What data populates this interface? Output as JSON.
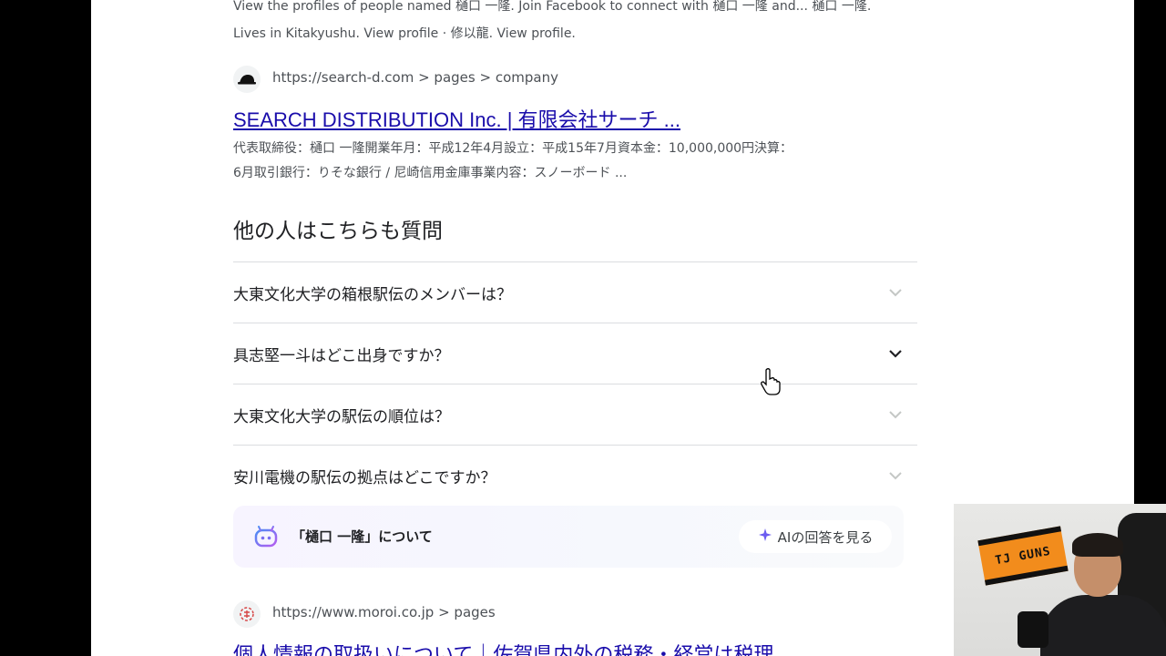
{
  "top_snippet": {
    "line1": "View the profiles of people named 樋口 一隆. Join Facebook to connect with 樋口 一隆 and... 樋口 一隆.",
    "line2": "Lives in Kitakyushu. View profile · 修以龍. View profile."
  },
  "result1": {
    "favicon": "hat-icon",
    "cite": "https://search-d.com > pages > company",
    "title": "SEARCH DISTRIBUTION Inc. | 有限会社サーチ ...",
    "desc_line1": "代表取締役：樋口 一隆開業年月：平成12年4月設立：平成15年7月資本金：10,000,000円決算：",
    "desc_line2": "6月取引銀行：りそな銀行 / 尼崎信用金庫事業内容：スノーボード ..."
  },
  "paa": {
    "heading": "他の人はこちらも質問",
    "questions": [
      "大東文化大学の箱根駅伝のメンバーは？",
      "具志堅一斗はどこ出身ですか？",
      "大東文化大学の駅伝の順位は？",
      "安川電機の駅伝の拠点はどこですか？"
    ]
  },
  "ai_overview": {
    "label": "「樋口 一隆」について",
    "button_label": "AIの回答を見る",
    "icon": "ai-robot-icon"
  },
  "result2": {
    "favicon": "moroi-logo-icon",
    "cite": "https://www.moroi.co.jp > pages",
    "title": "個人情報の取扱いについて｜佐賀県内外の税務・経営は税理"
  },
  "webcam": {
    "banner_text": "TJ GUNS"
  },
  "colors": {
    "link": "#1a0dab",
    "text": "#202124",
    "secondary": "#4d5156",
    "divider": "#dadce0"
  }
}
